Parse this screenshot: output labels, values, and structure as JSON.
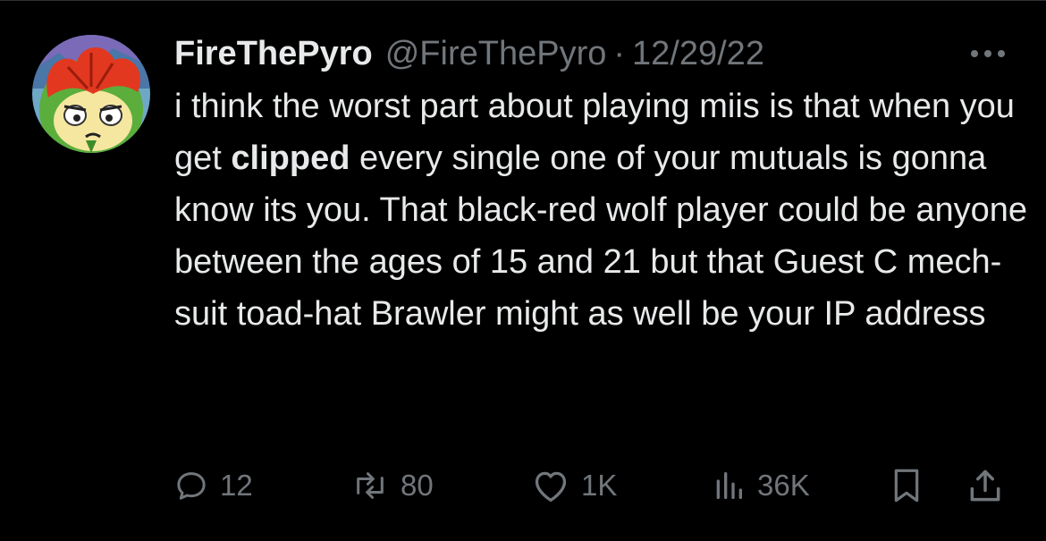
{
  "tweet": {
    "display_name": "FireThePyro",
    "handle": "@FireThePyro",
    "separator": "·",
    "date": "12/29/22",
    "more_icon": "more-horizontal-icon",
    "text_part1": "i think the worst part about playing miis is that when you get ",
    "text_bold": "clipped",
    "text_part2": " every single one of your mutuals is gonna know its you. That black-red wolf player could be anyone between the ages of 15 and 21 but that Guest C mech-suit toad-hat Brawler might as well be your IP address"
  },
  "actions": {
    "replies": "12",
    "retweets": "80",
    "likes": "1K",
    "views": "36K"
  },
  "colors": {
    "background": "#000000",
    "text": "#e7e9ea",
    "muted": "#71767b"
  }
}
